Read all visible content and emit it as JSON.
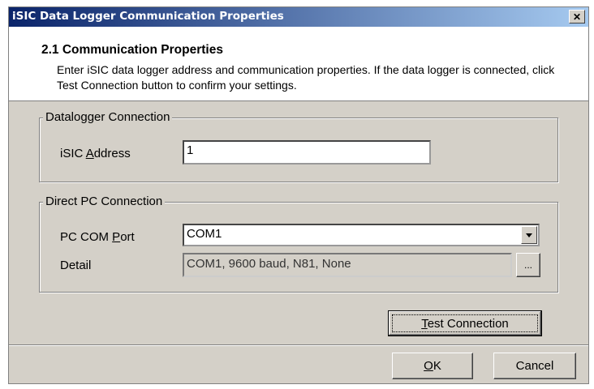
{
  "window": {
    "title": "iSIC Data Logger Communication Properties",
    "close_symbol": "✕"
  },
  "header": {
    "title": "2.1 Communication Properties",
    "description": "Enter iSIC data logger address and communication properties. If the data logger is connected, click Test Connection button to confirm your settings."
  },
  "datalogger_group": {
    "legend": "Datalogger Connection",
    "address_label_pre": "iSIC ",
    "address_label_u": "A",
    "address_label_post": "ddress",
    "address_value": "1"
  },
  "pc_group": {
    "legend": "Direct PC Connection",
    "port_label_pre": "PC COM ",
    "port_label_u": "P",
    "port_label_post": "ort",
    "port_value": "COM1",
    "detail_label": "Detail",
    "detail_value": "COM1, 9600 baud, N81, None",
    "detail_button": "..."
  },
  "buttons": {
    "test_u": "T",
    "test_post": "est Connection",
    "ok_u": "O",
    "ok_post": "K",
    "cancel": "Cancel"
  }
}
